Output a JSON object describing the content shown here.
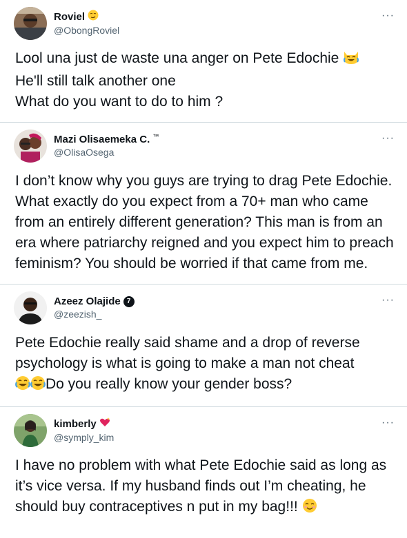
{
  "tweets": [
    {
      "display_name": "Roviel",
      "name_emoji": "smirk-face-emoji",
      "handle": "@ObongRoviel",
      "more": "···",
      "lines": [
        "Lool una just de waste una anger on Pete Edochie",
        "He'll still talk another one",
        "What do you want to do to him ?"
      ],
      "line1_emoji": "crying-laughing-cat-emoji"
    },
    {
      "display_name": "Mazi Olisaemeka C.",
      "name_suffix": "™",
      "handle": "@OlisaOsega",
      "more": "···",
      "text": "I don’t know why you guys are trying to drag Pete Edochie. What exactly do you expect from a 70+ man who came from an entirely different generation? This man is from an era where patriarchy reigned and you expect him to preach feminism? You should be worried if that came from me."
    },
    {
      "display_name": "Azeez Olajide",
      "badge_number": "7",
      "handle": "@zeezish_",
      "more": "···",
      "text_a": "Pete Edochie really said shame and a drop of reverse psychology is what is going to make a man not cheat",
      "text_b": "Do you really know your gender boss?",
      "emoji": "tears-of-joy-emoji"
    },
    {
      "display_name": "kimberly",
      "name_emoji": "sparkling-heart-emoji",
      "handle": "@symply_kim",
      "more": "···",
      "text": "I have no problem with what Pete Edochie said as long as it’s vice versa. If my husband finds out I’m cheating, he should buy contraceptives n put in my bag!!!",
      "end_emoji": "smiling-face-emoji"
    }
  ],
  "colors": {
    "text": "#0f1419",
    "secondary": "#536471",
    "divider": "#cfd9de",
    "emoji_yellow": "#ffcc33"
  }
}
